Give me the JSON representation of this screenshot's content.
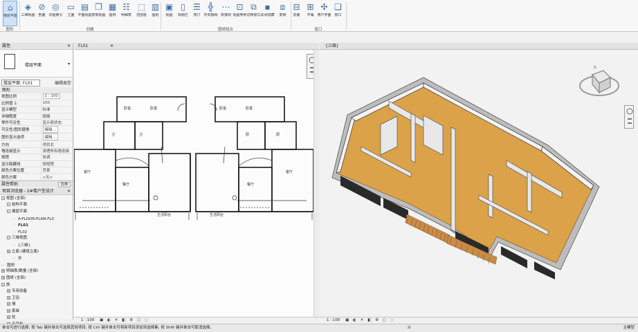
{
  "ribbon": {
    "buttons": [
      {
        "label": "楼层平面",
        "icon": "floor-plan-icon",
        "active": true
      },
      {
        "label": "三维视图",
        "icon": "3d-view-icon"
      },
      {
        "label": "剖面",
        "icon": "section-icon"
      },
      {
        "label": "详图索引",
        "icon": "callout-icon"
      },
      {
        "label": "立面",
        "icon": "elevation-icon"
      },
      {
        "label": "平面视图",
        "icon": "plan-view-icon"
      },
      {
        "label": "复制视图",
        "icon": "duplicate-view-icon"
      },
      {
        "label": "图例",
        "icon": "legend-icon"
      },
      {
        "label": "明细表",
        "icon": "schedule-icon"
      },
      {
        "label": "范围框",
        "icon": "scope-box-icon"
      },
      {
        "label": "图纸",
        "icon": "sheet-icon"
      },
      {
        "label": "视图",
        "icon": "view-icon"
      },
      {
        "label": "标题栏",
        "icon": "title-block-icon"
      },
      {
        "label": "修订",
        "icon": "revision-icon"
      },
      {
        "label": "导向轴网",
        "icon": "guide-grid-icon"
      },
      {
        "label": "拼接线",
        "icon": "matchline-icon"
      },
      {
        "label": "视图参照",
        "icon": "view-reference-icon"
      },
      {
        "label": "切换窗口",
        "icon": "switch-window-icon"
      },
      {
        "label": "关闭隐藏",
        "icon": "close-hidden-icon"
      },
      {
        "label": "复制",
        "icon": "replicate-icon"
      },
      {
        "label": "层叠",
        "icon": "cascade-icon"
      },
      {
        "label": "平铺",
        "icon": "tile-icon"
      },
      {
        "label": "用户界面",
        "icon": "user-interface-icon"
      },
      {
        "label": "窗口",
        "icon": "window-icon"
      }
    ],
    "groups": [
      "图形",
      "创建",
      "图纸组合",
      "窗口"
    ]
  },
  "properties": {
    "title": "属性",
    "type_name": "楼层平面",
    "selector": "楼层平面: FL01",
    "edit_type": "编辑类型",
    "category": "图形",
    "rows": [
      {
        "name": "视图比例",
        "value": "1 : 100",
        "boxed": true
      },
      {
        "name": "比例值 1:",
        "value": "100"
      },
      {
        "name": "显示模型",
        "value": "标准"
      },
      {
        "name": "详细程度",
        "value": "粗略"
      },
      {
        "name": "零件可见性",
        "value": "显示原状态"
      },
      {
        "name": "可见性/图形替换",
        "value": "编辑...",
        "boxed": true
      },
      {
        "name": "图形显示选项",
        "value": "编辑...",
        "boxed": true
      },
      {
        "name": "方向",
        "value": "项目北"
      },
      {
        "name": "墙连接显示",
        "value": "清理所有墙连接"
      },
      {
        "name": "规程",
        "value": "协调"
      },
      {
        "name": "显示隐藏线",
        "value": "按规程"
      },
      {
        "name": "颜色方案位置",
        "value": "背景"
      },
      {
        "name": "颜色方案",
        "value": "<无>"
      }
    ],
    "help": "属性帮助",
    "apply": "应用"
  },
  "browser": {
    "title": "项目浏览器 - 2#楼户型设计",
    "items": [
      {
        "text": "视图 (全部)",
        "level": 0,
        "toggle": "-"
      },
      {
        "text": "结构平面",
        "level": 1,
        "toggle": "-"
      },
      {
        "text": "楼层平面",
        "level": 1,
        "toggle": "-"
      },
      {
        "text": "A-FLOOR-PLAN-FL0",
        "level": 2
      },
      {
        "text": "FL01",
        "level": 2,
        "bold": true
      },
      {
        "text": "FL02",
        "level": 2
      },
      {
        "text": "三维视图",
        "level": 1,
        "toggle": "-"
      },
      {
        "text": "{三维}",
        "level": 2
      },
      {
        "text": "立面 (建筑立面)",
        "level": 1,
        "toggle": "+"
      },
      {
        "text": "东",
        "level": 2
      },
      {
        "text": "图例",
        "level": 0
      },
      {
        "text": "明细表/数量 (全部)",
        "level": 0,
        "toggle": "+"
      },
      {
        "text": "图纸 (全部)",
        "level": 0,
        "toggle": "+"
      },
      {
        "text": "族",
        "level": 0,
        "toggle": "-"
      },
      {
        "text": "专用设备",
        "level": 1,
        "toggle": "+"
      },
      {
        "text": "卫浴",
        "level": 1,
        "toggle": "+"
      },
      {
        "text": "墙",
        "level": 1,
        "toggle": "+"
      },
      {
        "text": "家具",
        "level": 1,
        "toggle": "+"
      },
      {
        "text": "柱",
        "level": 1,
        "toggle": "+"
      },
      {
        "text": "天花板",
        "level": 1,
        "toggle": "+"
      }
    ]
  },
  "plan_view": {
    "tab": "FL01",
    "status_scale": "1 : 100",
    "rooms": [
      "卧室",
      "卧室",
      "卧室",
      "卧室",
      "卫",
      "卫",
      "厨",
      "厨",
      "客厅",
      "客厅",
      "餐厅",
      "餐厅",
      "生活阳台",
      "生活阳台"
    ]
  },
  "view_3d": {
    "tab": "{三维}",
    "status_scale": "1 : 100"
  },
  "status_bar": {
    "text": "单击可进行选择; 按 Tab 键并单击可选择其他项目; 按 Ctrl 键并单击可将新项目添加到选择集; 按 Shift 键并单击可取消选择。",
    "count": ":0",
    "model": "主模型"
  },
  "colors": {
    "floor": "#d9a24a",
    "accent": "#2f6db5"
  }
}
